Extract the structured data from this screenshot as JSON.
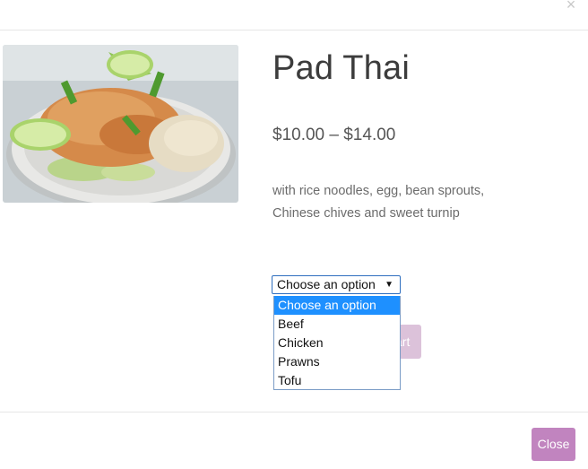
{
  "modal": {
    "close_glyph": "×",
    "close_button_label": "Close"
  },
  "product": {
    "title": "Pad Thai",
    "price": "$10.00 – $14.00",
    "description_line1": "with rice noodles, egg, bean sprouts,",
    "description_line2": "Chinese chives and sweet turnip",
    "add_to_cart_fragment": "art"
  },
  "variation_select": {
    "current_value": "Choose an option",
    "caret": "▼",
    "options": [
      "Choose an option",
      "Beef",
      "Chicken",
      "Prawns",
      "Tofu"
    ],
    "highlighted_option": "Choose an option"
  },
  "colors": {
    "accent": "#c184bf",
    "accent_disabled": "#dcc2da",
    "option_highlight": "#1e90ff"
  }
}
